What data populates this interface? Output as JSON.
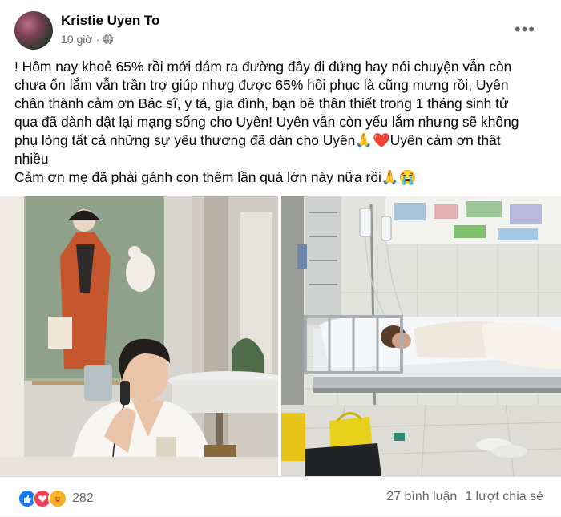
{
  "post": {
    "author": "Kristie Uyen To",
    "time": "10 giờ",
    "privacy_icon": "globe-icon",
    "more_icon": "more-horizontal-icon",
    "text_lines": [
      "! Hôm nay khoẻ 65% rồi mới dám ra đường đây đi đứng hay nói chuyện vẫn còn",
      "chưa ổn lắm vẫn trần trợ giúp nhưg được 65% hồi phục là cũng mưng rồi, Uyên",
      "chân thành cảm ơn Bác sĩ, y tá, gia đình, bạn bè thân thiết trong 1 tháng sinh tử",
      "qua đã dành dật lại mạng sống cho Uyên! Uyên vẫn còn yếu lắm nhưng sẽ không",
      "phụ lòng tất cả những sự yêu thương đã dàn cho Uyên🙏❤️Uyên cảm ơn thât",
      "nhiều",
      "Cảm ơn mẹ đã phải gánh con thêm lần quá lớn này nữa rồi🙏😭"
    ]
  },
  "photos": [
    {
      "description_icon": "photo-woman-on-phone"
    },
    {
      "description_icon": "photo-hospital-bed"
    }
  ],
  "footer": {
    "reactions": [
      "like-icon",
      "love-icon",
      "care-icon"
    ],
    "reaction_count": "282",
    "comments": "27 bình luận",
    "shares": "1 lượt chia sẻ"
  },
  "colors": {
    "like": "#1877f2",
    "love": "#f33e58",
    "care": "#f7b125",
    "secondary_text": "#65676b"
  }
}
